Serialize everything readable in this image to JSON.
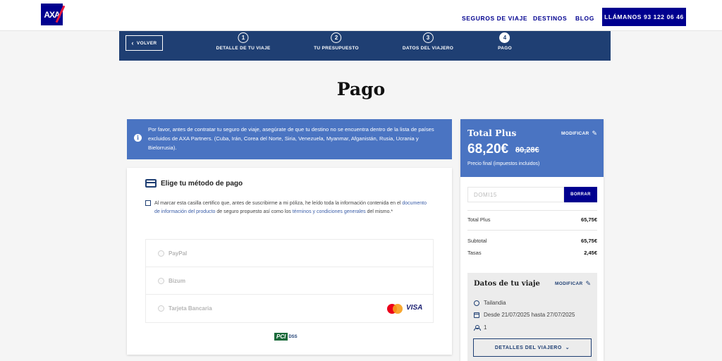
{
  "header": {
    "logo_text": "AXA",
    "nav": [
      "SEGUROS DE VIAJE",
      "DESTINOS",
      "BLOG"
    ],
    "call_label": "LLÁMANOS 93 122 06 46",
    "brand_color": "#00008f"
  },
  "steps": {
    "back_label": "VOLVER",
    "items": [
      {
        "num": "1",
        "label": "DETALLE DE TU VIAJE"
      },
      {
        "num": "2",
        "label": "TU PRESUPUESTO"
      },
      {
        "num": "3",
        "label": "DATOS DEL VIAJERO"
      },
      {
        "num": "4",
        "label": "PAGO"
      }
    ],
    "active": "4"
  },
  "page_title": "Pago",
  "info_banner": "Por favor, antes de contratar tu seguro de viaje, asegúrate de que tu destino no se encuentra dentro de la lista de países excluidos de AXA Partners. (Cuba, Irán, Corea del Norte, Siria, Venezuela, Myanmar, Afganistán, Rusia, Ucrania y Bielorrusia).",
  "payment": {
    "title": "Elige tu método de pago",
    "consent": {
      "part1": "Al marcar esta casilla certifico que, antes de suscribirme a mi póliza, he leído toda la información contenida en el ",
      "link1": "documento de información del producto",
      "part2": " de seguro propuesto así como los ",
      "link2": "términos y condiciones generales",
      "part3": " del mismo.*"
    },
    "methods": [
      "PayPal",
      "Bizum",
      "Tarjeta Bancaria"
    ],
    "visa_label": "VISA",
    "pci_label": "PCI",
    "pci_dss": "DSS"
  },
  "summary": {
    "plan_name": "Total Plus",
    "modify_label": "MODIFICAR",
    "price": "68,20€",
    "old_price": "80,28€",
    "price_note": "Precio final (impuestos incluidos)",
    "promo_code": "DOMI15",
    "promo_button": "BORRAR",
    "rows": [
      {
        "label": "Total Plus",
        "value": "65,75€"
      },
      {
        "label": "Subtotal",
        "value": "65,75€"
      },
      {
        "label": "Tasas",
        "value": "2,45€"
      }
    ]
  },
  "trip": {
    "title": "Datos de tu viaje",
    "modify_label": "MODIFICAR",
    "destination": "Tailandia",
    "dates": "Desde 21/07/2025 hasta 27/07/2025",
    "travelers": "1",
    "details_button": "DETALLES DEL VIAJERO"
  }
}
